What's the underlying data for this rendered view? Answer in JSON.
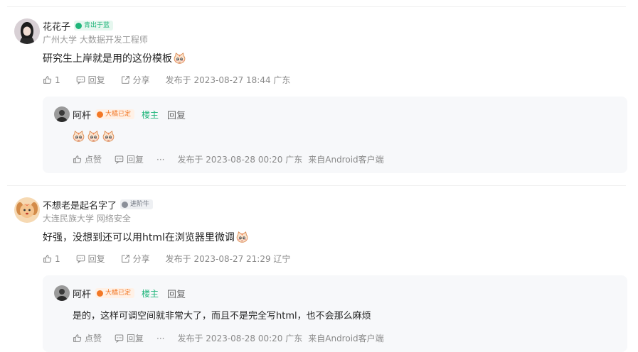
{
  "comments": [
    {
      "username": "花花子",
      "badge": "青出于蓝",
      "subtitle": "广州大学 大数据开发工程师",
      "content": "研究生上岸就是用的这份模板",
      "likes": "1",
      "reply_label": "回复",
      "share_label": "分享",
      "meta": "发布于 2023-08-27 18:44 广东",
      "reply": {
        "username": "阿杆",
        "badge": "大橘已定",
        "owner_label": "楼主",
        "reply_label": "回复",
        "content": "",
        "like_label": "点赞",
        "reply_action_label": "回复",
        "more_label": "···",
        "meta": "发布于 2023-08-28 00:20 广东",
        "client": "来自Android客户端"
      }
    },
    {
      "username": "不想老是起名字了",
      "badge": "进阶牛",
      "subtitle": "大连民族大学 网络安全",
      "content": "好强，没想到还可以用html在浏览器里微调",
      "likes": "1",
      "reply_label": "回复",
      "share_label": "分享",
      "meta": "发布于 2023-08-27 21:29 辽宁",
      "reply": {
        "username": "阿杆",
        "badge": "大橘已定",
        "owner_label": "楼主",
        "reply_label": "回复",
        "content": "是的，这样可调空间就非常大了，而且不是完全写html，也不会那么麻烦",
        "like_label": "点赞",
        "reply_action_label": "回复",
        "more_label": "···",
        "meta": "发布于 2023-08-28 00:20 广东",
        "client": "来自Android客户端"
      }
    }
  ],
  "colors": {
    "owner": "#1fb57a",
    "badge_green": "#1fb57a",
    "badge_orange": "#f27826",
    "badge_gray": "#8a8f99"
  },
  "icons": [
    "thumb-up-icon",
    "comment-icon",
    "share-icon",
    "cat-emoji-icon"
  ]
}
